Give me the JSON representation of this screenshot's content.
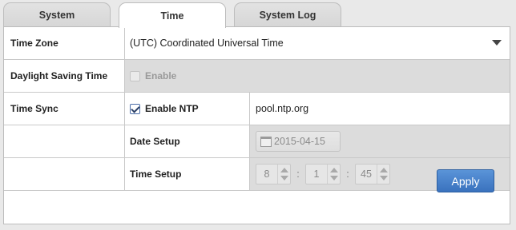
{
  "tabs": [
    {
      "label": "System",
      "active": false
    },
    {
      "label": "Time",
      "active": true
    },
    {
      "label": "System Log",
      "active": false
    }
  ],
  "rows": {
    "time_zone": {
      "label": "Time Zone",
      "value": "(UTC) Coordinated Universal Time"
    },
    "dst": {
      "label": "Daylight Saving Time",
      "checkbox_label": "Enable",
      "checked": false,
      "disabled": true
    },
    "time_sync": {
      "label": "Time Sync",
      "checkbox_label": "Enable NTP",
      "checked": true,
      "server": "pool.ntp.org"
    },
    "date_setup": {
      "label": "Date Setup",
      "value": "2015-04-15"
    },
    "time_setup": {
      "label": "Time Setup",
      "hour": "8",
      "minute": "1",
      "second": "45",
      "separator": ":"
    }
  },
  "apply_label": "Apply",
  "icons": {
    "dropdown": "chevron-down-icon",
    "calendar": "calendar-icon",
    "check": "checkmark-icon"
  }
}
